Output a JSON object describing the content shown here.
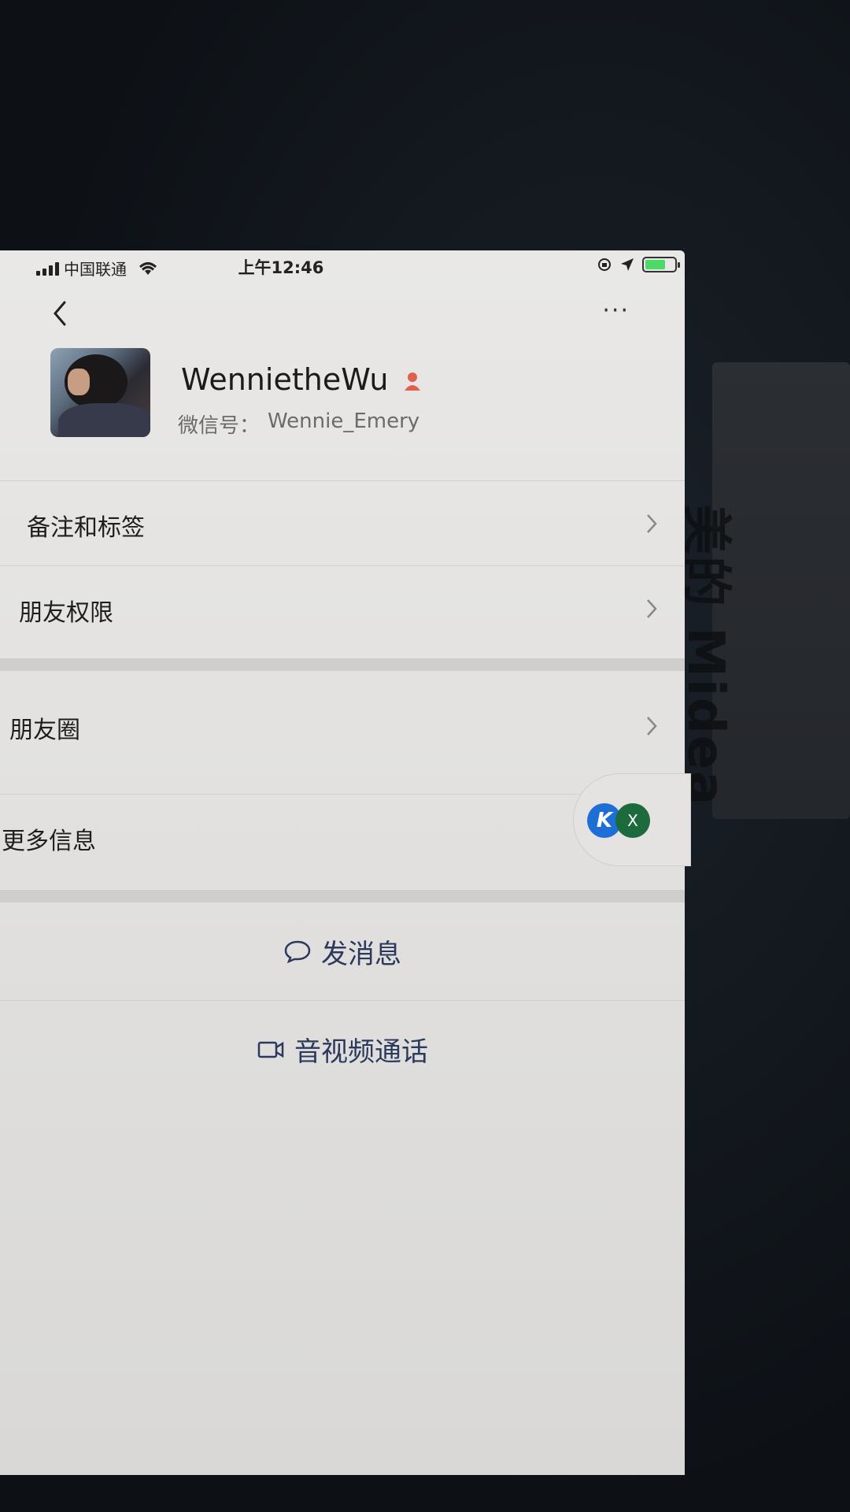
{
  "status_bar": {
    "carrier": "中国联通",
    "time": "上午12:46",
    "battery_level": 0.7
  },
  "nav": {
    "back_icon": "chevron-left-icon",
    "more_icon": "ellipsis-icon",
    "more_label": "···"
  },
  "profile": {
    "name": "WenniethеWu",
    "wechat_id_label": "微信号：",
    "wechat_id": "Wennie_Emery",
    "gender_icon": "female-icon"
  },
  "menu": {
    "remark_tags": "备注和标签",
    "friend_permissions": "朋友权限",
    "moments": "朋友圈",
    "more_info": "更多信息"
  },
  "actions": {
    "send_message": "发消息",
    "av_call": "音视频通话"
  },
  "floating": {
    "app1_label": "K",
    "app2_label": "X"
  },
  "background": {
    "brand": "美的 Midea"
  },
  "colors": {
    "action_text": "#2b3a5c",
    "gender_icon": "#e0604f",
    "battery": "#4cd964"
  }
}
